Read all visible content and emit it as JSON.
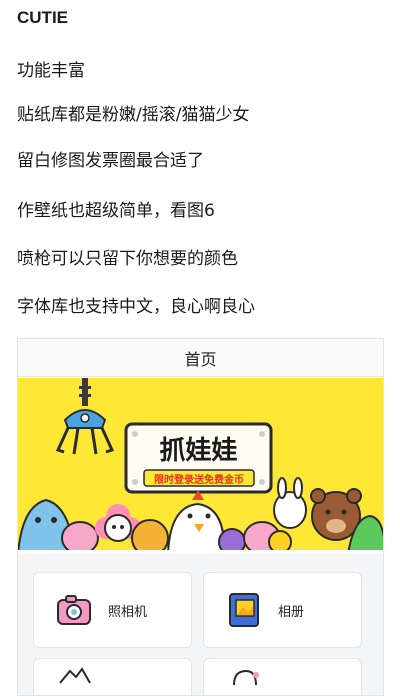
{
  "article": {
    "title": "CUTIE",
    "paragraphs": [
      "功能丰富",
      "贴纸库都是粉嫩/摇滚/猫猫少女",
      "留白修图发票圈最合适了",
      "作壁纸也超级简单，看图6",
      "喷枪可以只留下你想要的颜色",
      "字体库也支持中文，良心啊良心"
    ]
  },
  "app": {
    "header_title": "首页",
    "banner": {
      "title": "抓娃娃",
      "subtitle": "限时登录送免费金币",
      "background": "#ffe835"
    },
    "menu": [
      {
        "label": "照相机",
        "icon": "camera-icon"
      },
      {
        "label": "相册",
        "icon": "album-icon"
      },
      {
        "label": "",
        "icon": "mountain-icon"
      },
      {
        "label": "",
        "icon": "sticker-icon"
      }
    ]
  },
  "colors": {
    "accent_yellow": "#ffe835",
    "label_red": "#e5331c",
    "camera_pink": "#f29ac2",
    "album_blue": "#3d6fd6"
  }
}
